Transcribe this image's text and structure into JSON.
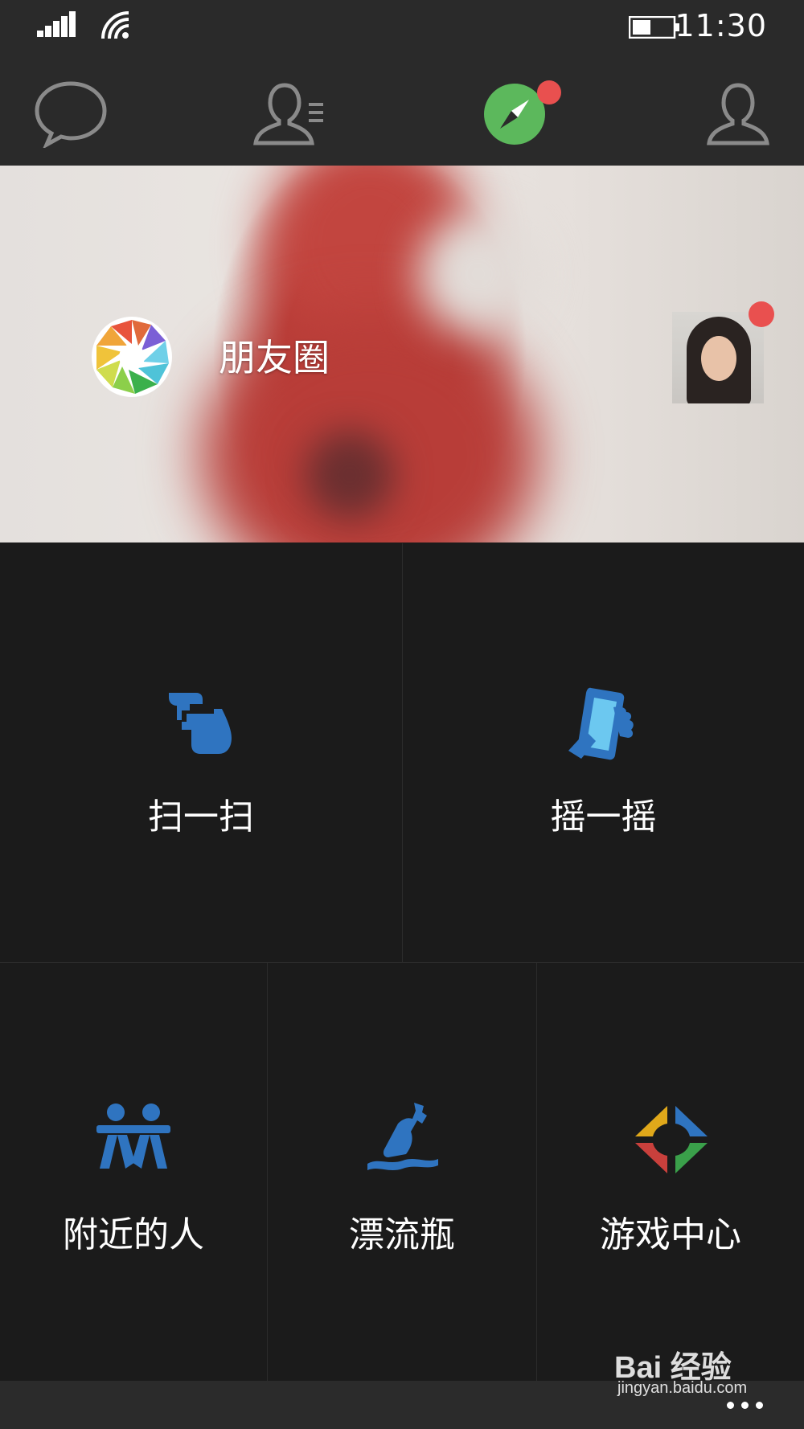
{
  "status_bar": {
    "time": "11:30",
    "icons": [
      "signal-icon",
      "wifi-icon",
      "battery-icon"
    ],
    "battery_level": 0.45
  },
  "nav_tabs": [
    {
      "name": "chats",
      "icon": "chat-bubble-icon",
      "active": false
    },
    {
      "name": "contacts",
      "icon": "contacts-icon",
      "active": false
    },
    {
      "name": "discover",
      "icon": "compass-icon",
      "active": true,
      "badge": true
    },
    {
      "name": "me",
      "icon": "person-icon",
      "active": false
    }
  ],
  "moments": {
    "title": "朋友圈",
    "icon": "moments-shutter-icon",
    "has_new_badge": true
  },
  "tiles": [
    {
      "label": "扫一扫",
      "icon": "scan-icon"
    },
    {
      "label": "摇一摇",
      "icon": "shake-phone-icon"
    },
    {
      "label": "附近的人",
      "icon": "nearby-people-icon"
    },
    {
      "label": "漂流瓶",
      "icon": "drift-bottle-icon"
    },
    {
      "label": "游戏中心",
      "icon": "game-center-icon"
    }
  ],
  "watermark": {
    "brand": "Bai 经验",
    "url": "jingyan.baidu.com"
  },
  "colors": {
    "background": "#1a1a1a",
    "bar": "#2a2a2a",
    "accent_green": "#5cb85c",
    "badge_red": "#e9504f",
    "icon_blue": "#2f74c0"
  }
}
